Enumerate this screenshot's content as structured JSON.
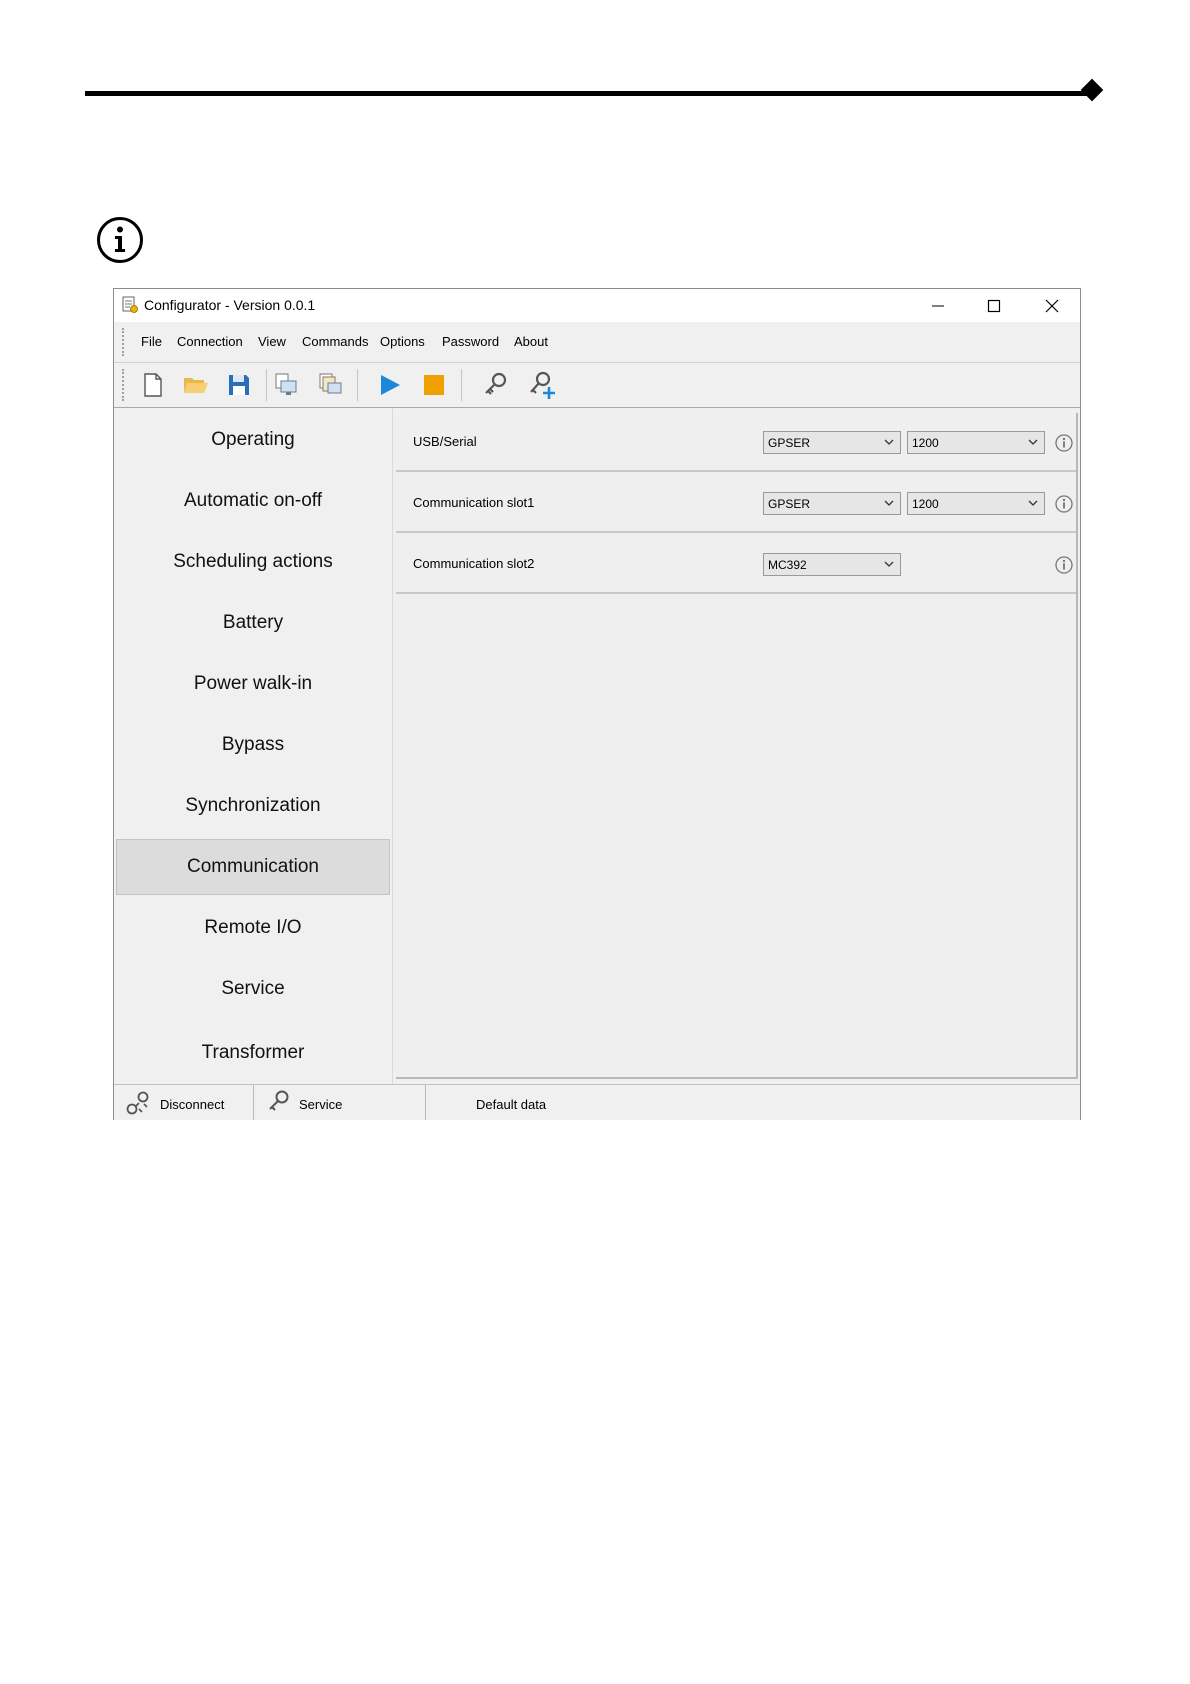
{
  "window": {
    "title": "Configurator - Version 0.0.1"
  },
  "menu": [
    "File",
    "Connection",
    "View",
    "Commands",
    "Options",
    "Password",
    "About"
  ],
  "toolbar_icons": [
    "new-file-icon",
    "open-folder-icon",
    "save-icon",
    "upload-to-device-icon",
    "download-from-device-icon",
    "play-icon",
    "stop-icon",
    "key-icon",
    "add-user-icon"
  ],
  "sidebar": {
    "items": [
      "Operating",
      "Automatic on-off",
      "Scheduling actions",
      "Battery",
      "Power walk-in",
      "Bypass",
      "Synchronization",
      "Communication",
      "Remote I/O",
      "Service",
      "Transformer"
    ],
    "active": "Communication"
  },
  "communication": {
    "rows": [
      {
        "label": "USB/Serial",
        "protocol": "GPSER",
        "baud": "1200"
      },
      {
        "label": "Communication slot1",
        "protocol": "GPSER",
        "baud": "1200"
      },
      {
        "label": "Communication slot2",
        "protocol": "MC392"
      }
    ]
  },
  "statusbar": {
    "disconnect": "Disconnect",
    "service": "Service",
    "data_source": "Default data"
  },
  "colors": {
    "play": "#1e88d8",
    "stop": "#f0a000",
    "save": "#2a6fb8",
    "folder": "#f3c35a"
  }
}
